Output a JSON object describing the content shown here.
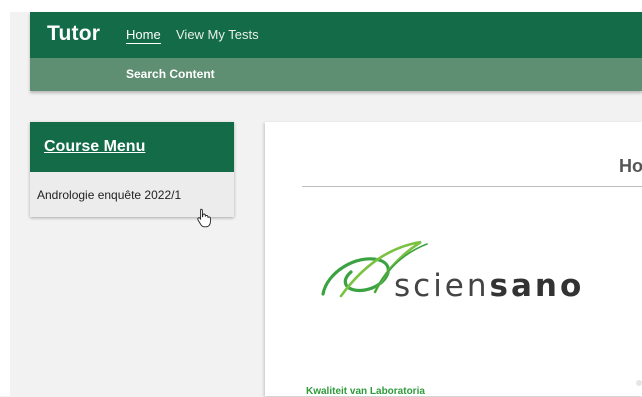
{
  "header": {
    "brand": "Tutor",
    "nav": [
      {
        "label": "Home",
        "active": true
      },
      {
        "label": "View My Tests",
        "active": false
      }
    ],
    "search_link": "Search Content"
  },
  "course_menu": {
    "title": "Course Menu",
    "items": [
      "Andrologie enquête 2022/1"
    ]
  },
  "content": {
    "title": "Ho",
    "logo": {
      "light": "scien",
      "bold": "sano"
    },
    "footer_link": "Kwaliteit van Laboratoria"
  },
  "colors": {
    "brand_green": "#136b47",
    "subbar_green": "#5f8f73",
    "logo_green": "#3aa241",
    "link_green": "#2e9b3c"
  }
}
